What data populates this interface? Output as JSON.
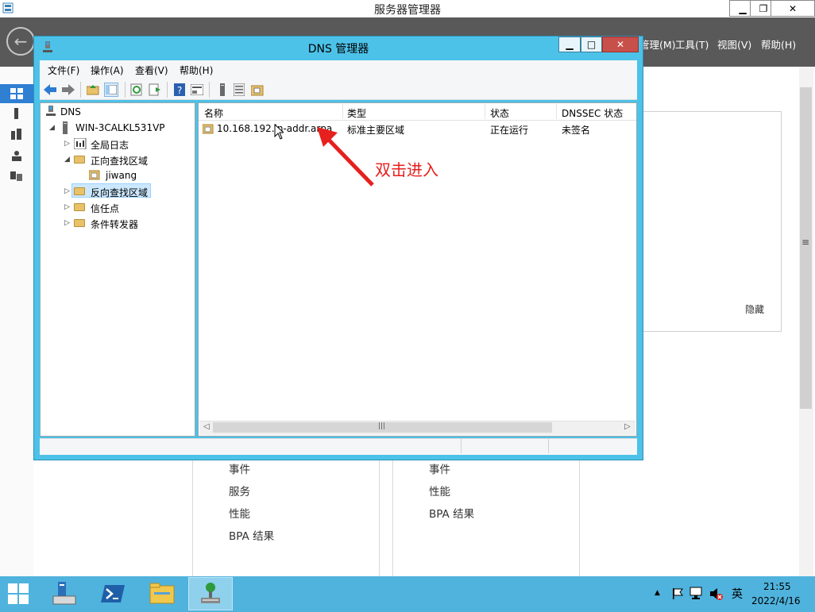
{
  "server_manager": {
    "title": "服务器管理器",
    "menus": [
      "管理(M)",
      "工具(T)",
      "视图(V)",
      "帮助(H)"
    ],
    "hide_label": "隐藏",
    "cards": [
      {
        "items": [
          "事件",
          "服务",
          "性能",
          "BPA 结果"
        ]
      },
      {
        "items": [
          "事件",
          "性能",
          "BPA 结果"
        ]
      }
    ]
  },
  "dns_window": {
    "title": "DNS 管理器",
    "menu": [
      "文件(F)",
      "操作(A)",
      "查看(V)",
      "帮助(H)"
    ],
    "tree": {
      "root": "DNS",
      "server": "WIN-3CALKL531VP",
      "global_logs": "全局日志",
      "forward_zones": "正向查找区域",
      "forward_child": "jiwang",
      "reverse_zones": "反向查找区域",
      "trust_points": "信任点",
      "conditional_forwarders": "条件转发器"
    },
    "columns": [
      "名称",
      "类型",
      "状态",
      "DNSSEC 状态"
    ],
    "rows": [
      {
        "name": "10.168.192.in-addr.arpa",
        "type": "标准主要区域",
        "status": "正在运行",
        "dnssec": "未签名"
      }
    ]
  },
  "annotation": {
    "text": "双击进入",
    "color": "#e6201e"
  },
  "taskbar": {
    "time": "21:55",
    "date": "2022/4/16",
    "ime": "英"
  },
  "colors": {
    "window_frame": "#4cc2e8",
    "taskbar": "#4fb3dd",
    "header": "#595959",
    "close_button": "#c7504a"
  }
}
